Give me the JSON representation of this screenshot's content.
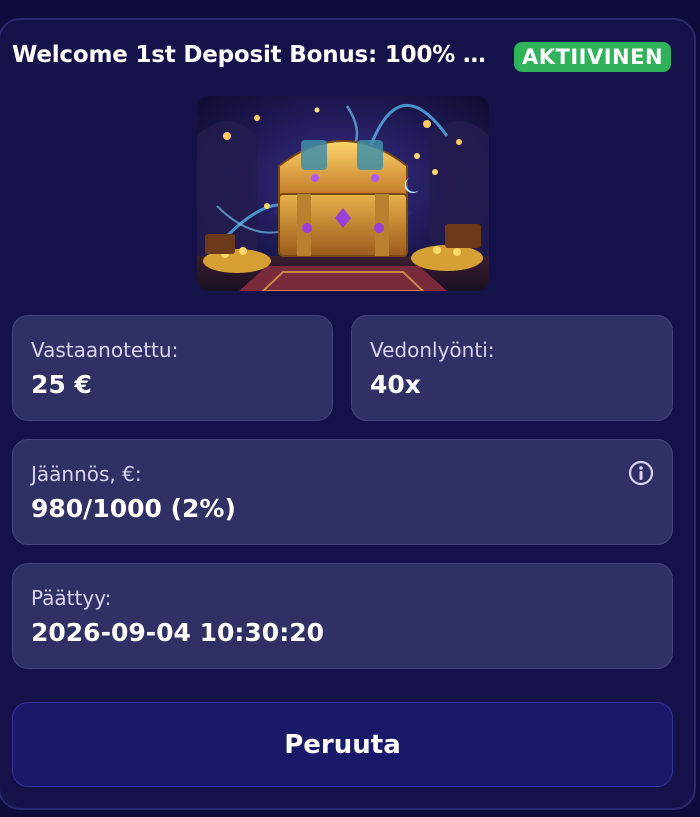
{
  "bonus": {
    "title": "Welcome 1st Deposit Bonus: 100% …",
    "status": "AKTIIVINEN",
    "image": "treasure-chest-banner"
  },
  "stats": {
    "received": {
      "label": "Vastaanotettu:",
      "value": "25 €"
    },
    "wagering": {
      "label": "Vedonlyönti:",
      "value": "40x"
    },
    "balance": {
      "label": "Jäännös, €:",
      "value": "980/1000 (2%)",
      "icon": "info-icon"
    },
    "expires": {
      "label": "Päättyy:",
      "value": "2026-09-04 10:30:20"
    }
  },
  "actions": {
    "cancel_label": "Peruuta"
  },
  "colors": {
    "background": "#0d0c3a",
    "card": "#141248",
    "tile": "#303064",
    "status_green": "#2fb25a",
    "button": "#1a1868"
  }
}
